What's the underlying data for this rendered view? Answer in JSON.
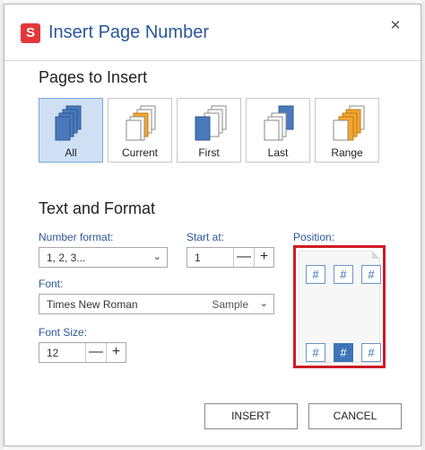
{
  "dialog": {
    "title": "Insert Page Number",
    "logo_letter": "S",
    "close_glyph": "✕"
  },
  "pages_to_insert": {
    "heading": "Pages to Insert",
    "options": [
      {
        "label": "All",
        "icon": "all-pages-icon",
        "selected": true
      },
      {
        "label": "Current",
        "icon": "current-page-icon",
        "selected": false
      },
      {
        "label": "First",
        "icon": "first-page-icon",
        "selected": false
      },
      {
        "label": "Last",
        "icon": "last-page-icon",
        "selected": false
      },
      {
        "label": "Range",
        "icon": "range-pages-icon",
        "selected": false
      }
    ]
  },
  "text_and_format": {
    "heading": "Text and Format",
    "number_format": {
      "label": "Number format:",
      "value": "1, 2, 3..."
    },
    "start_at": {
      "label": "Start at:",
      "value": "1"
    },
    "font": {
      "label": "Font:",
      "value": "Times New Roman",
      "sample": "Sample"
    },
    "font_size": {
      "label": "Font Size:",
      "value": "12"
    },
    "stepper": {
      "minus": "—",
      "plus": "+"
    }
  },
  "position": {
    "label": "Position:",
    "glyph": "#",
    "selected": "bottom-center"
  },
  "buttons": {
    "insert": "INSERT",
    "cancel": "CANCEL"
  },
  "colors": {
    "accent": "#2b5797",
    "selected_tile_bg": "#cfe0f4",
    "highlight_box": "#cc1c24",
    "page_blue": "#4a79bb",
    "page_orange": "#f4a531"
  }
}
